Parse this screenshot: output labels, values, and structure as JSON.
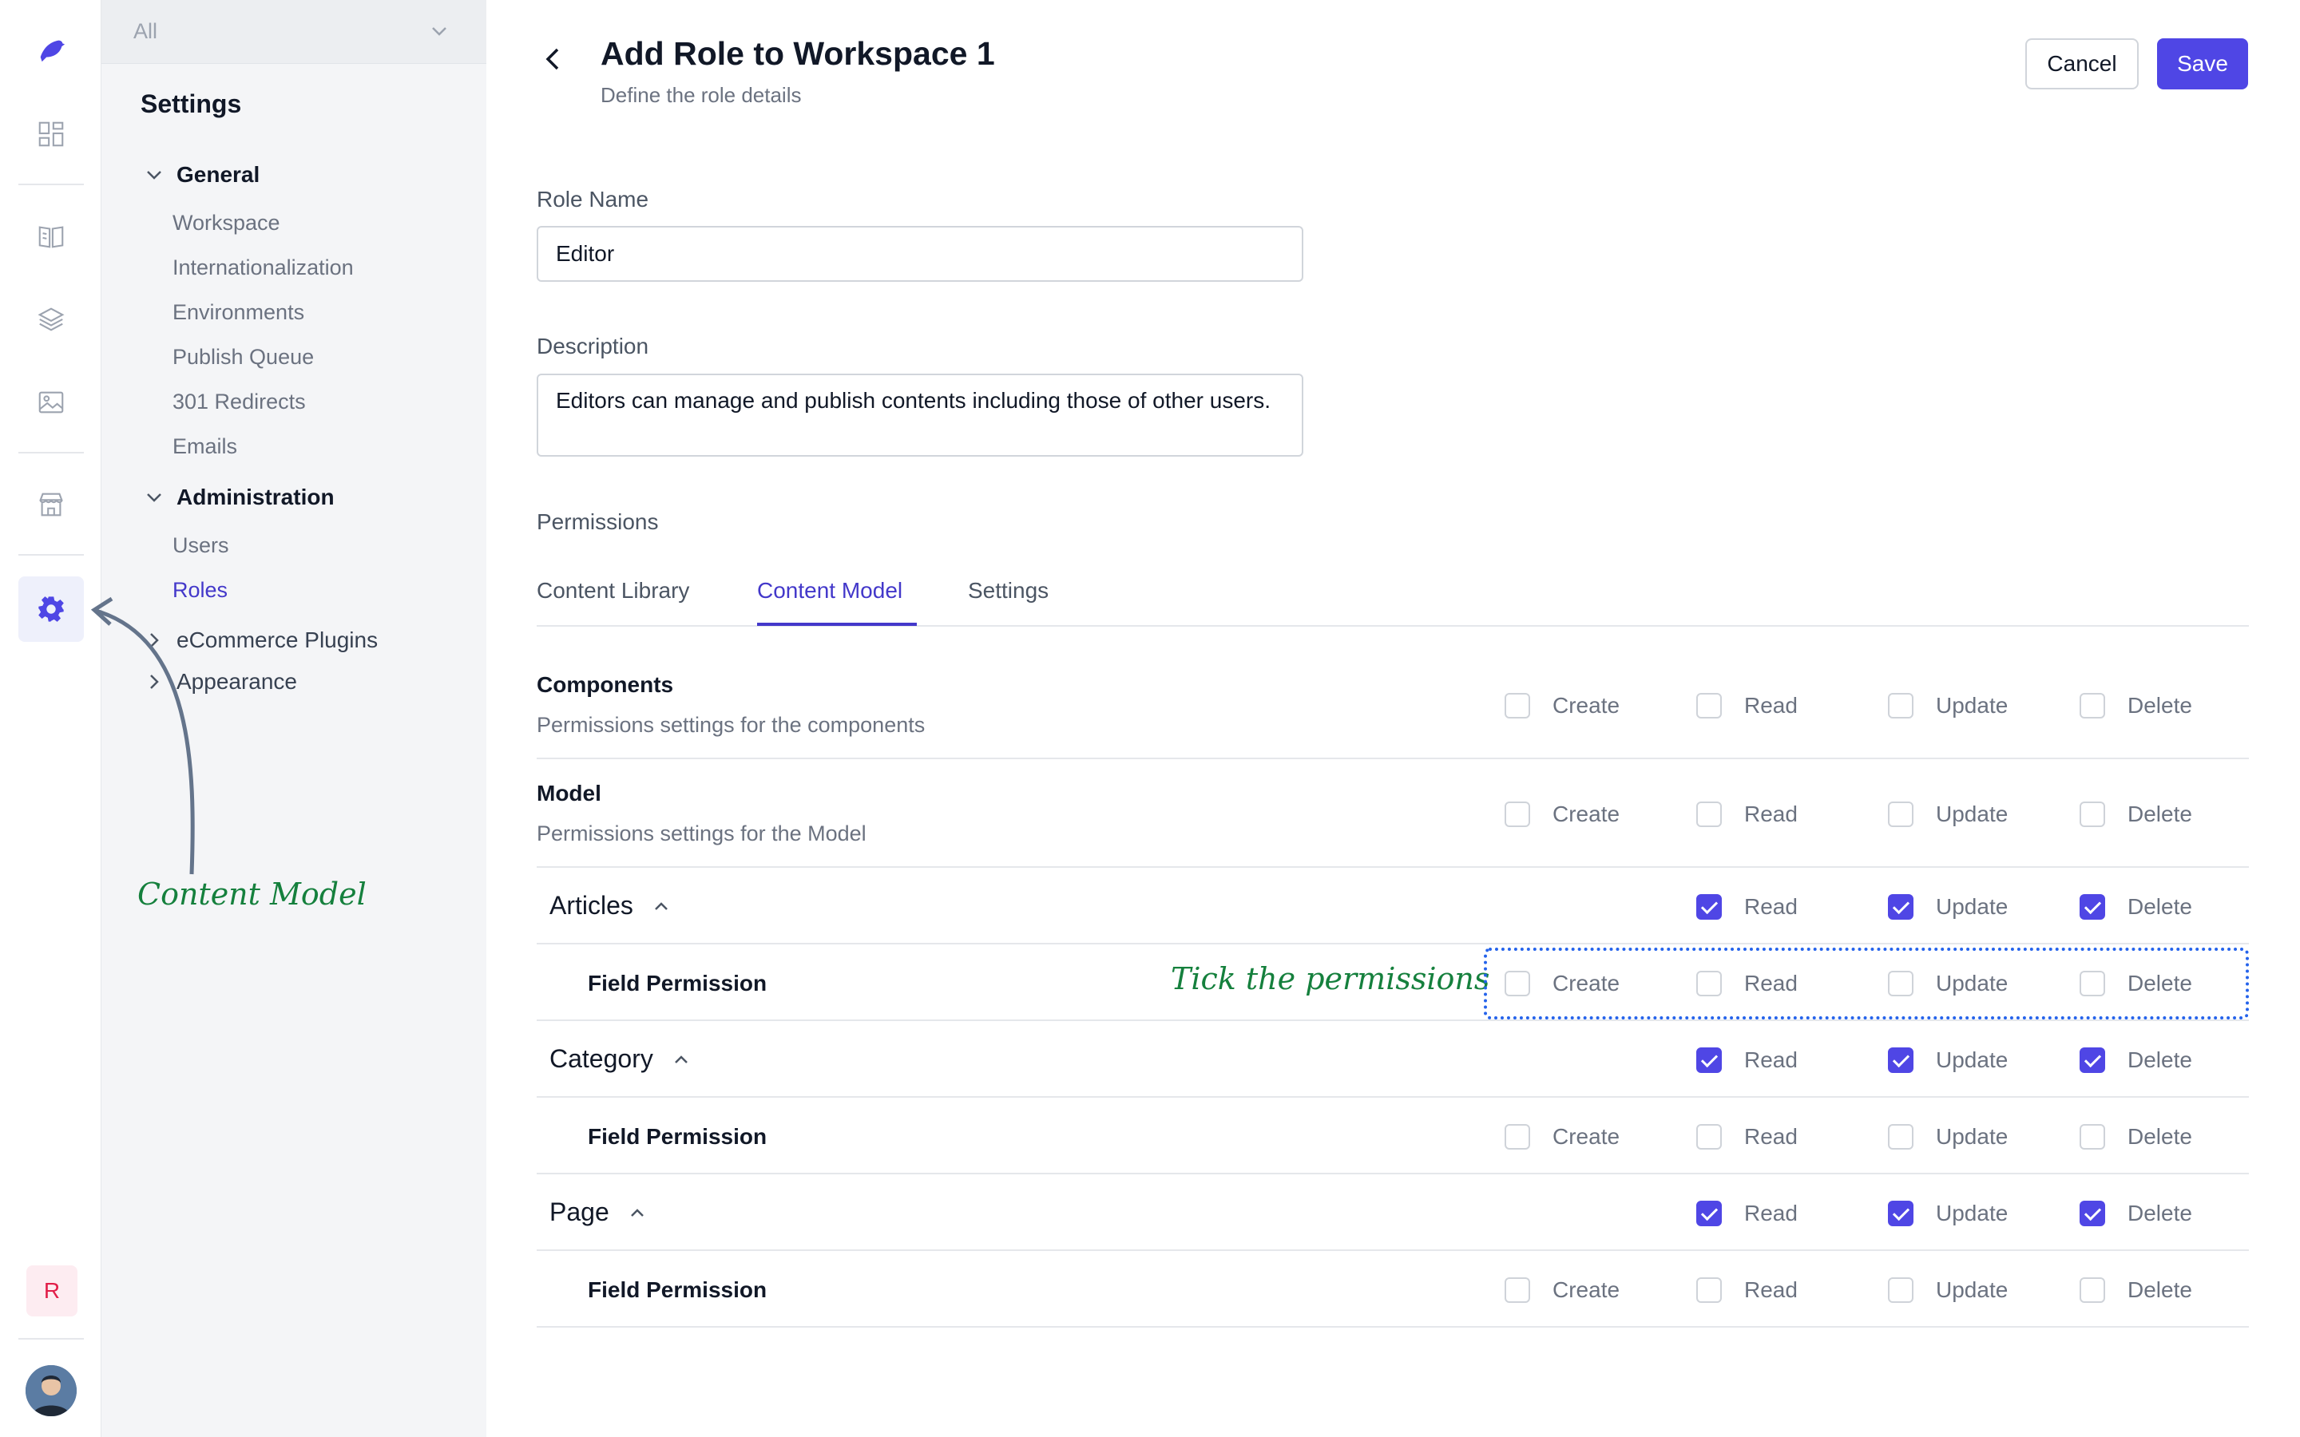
{
  "rail": {
    "icons": [
      "logo-bird-icon",
      "dashboard-icon",
      "book-icon",
      "layers-icon",
      "image-icon",
      "store-icon",
      "gear-icon"
    ],
    "workspace_initial": "R"
  },
  "sidebar": {
    "workspace_select": "All",
    "title": "Settings",
    "groups": [
      {
        "label": "General",
        "items": [
          "Workspace",
          "Internationalization",
          "Environments",
          "Publish Queue",
          "301 Redirects",
          "Emails"
        ]
      },
      {
        "label": "Administration",
        "items": [
          "Users",
          "Roles"
        ]
      }
    ],
    "collapsed": [
      "eCommerce Plugins",
      "Appearance"
    ],
    "active_item": "Roles"
  },
  "header": {
    "title": "Add Role to Workspace 1",
    "subtitle": "Define the role details",
    "cancel_label": "Cancel",
    "save_label": "Save"
  },
  "form": {
    "role_name_label": "Role Name",
    "role_name_value": "Editor",
    "description_label": "Description",
    "description_value": "Editors can manage and publish contents including those of other users.",
    "permissions_label": "Permissions"
  },
  "tabs": [
    "Content Library",
    "Content Model",
    "Settings"
  ],
  "active_tab": "Content Model",
  "permission_labels": [
    "Create",
    "Read",
    "Update",
    "Delete"
  ],
  "rows": [
    {
      "title": "Components",
      "desc": "Permissions settings for the components"
    },
    {
      "title": "Model",
      "desc": "Permissions settings for the Model"
    }
  ],
  "sections": [
    {
      "title": "Articles",
      "field_label": "Field Permission",
      "read": true,
      "update": true,
      "delete": true
    },
    {
      "title": "Category",
      "field_label": "Field Permission",
      "read": true,
      "update": true,
      "delete": true
    },
    {
      "title": "Page",
      "field_label": "Field Permission",
      "read": true,
      "update": true,
      "delete": true
    }
  ],
  "annotations": {
    "content_model": "Content Model",
    "tick_permissions": "Tick the permissions"
  },
  "colors": {
    "accent": "#4f46e5",
    "annotation": "#15803d",
    "highlight_box": "#2563eb"
  }
}
